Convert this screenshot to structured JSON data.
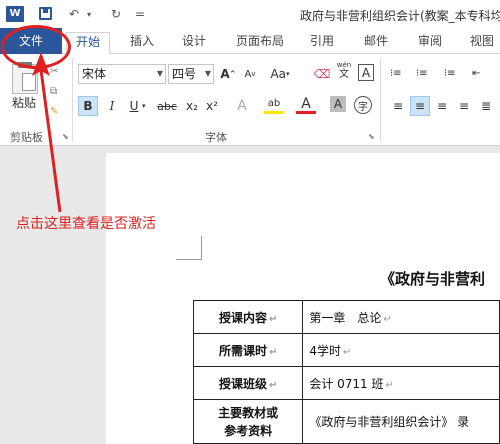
{
  "titlebar": {
    "logo": "W",
    "undo": "↶",
    "redo": "↻",
    "more": "=",
    "title": "政府与非营利组织会计(教案_本专科均"
  },
  "tabs": [
    "文件",
    "开始",
    "插入",
    "设计",
    "页面布局",
    "引用",
    "邮件",
    "审阅",
    "视图"
  ],
  "ribbon": {
    "clipboard": {
      "paste": "粘贴",
      "group": "剪贴板"
    },
    "font": {
      "name": "宋体",
      "size": "四号",
      "grow": "A",
      "shrink": "A",
      "case": "Aa",
      "wen": "wén",
      "wen2": "文",
      "border_a": "A",
      "bold": "B",
      "italic": "I",
      "underline": "U",
      "strike": "abc",
      "sub": "x₂",
      "sup": "x²",
      "effect": "A",
      "highlight": "ab",
      "color": "A",
      "shade": "A",
      "circle": "字",
      "group": "字体"
    }
  },
  "document": {
    "title": "《政府与非营利",
    "rows": [
      {
        "key": "授课内容",
        "value": "第一章　总论"
      },
      {
        "key": "所需课时",
        "value": "4学时"
      },
      {
        "key": "授课班级",
        "value": "会计 0711 班"
      },
      {
        "key": "主要教材或\n参考资料",
        "value": "《政府与非营利组织会计》 录"
      }
    ]
  },
  "annotation": {
    "text": "点击这里查看是否激活"
  },
  "colors": {
    "accent": "#2b579a",
    "annotation": "#e02020"
  }
}
